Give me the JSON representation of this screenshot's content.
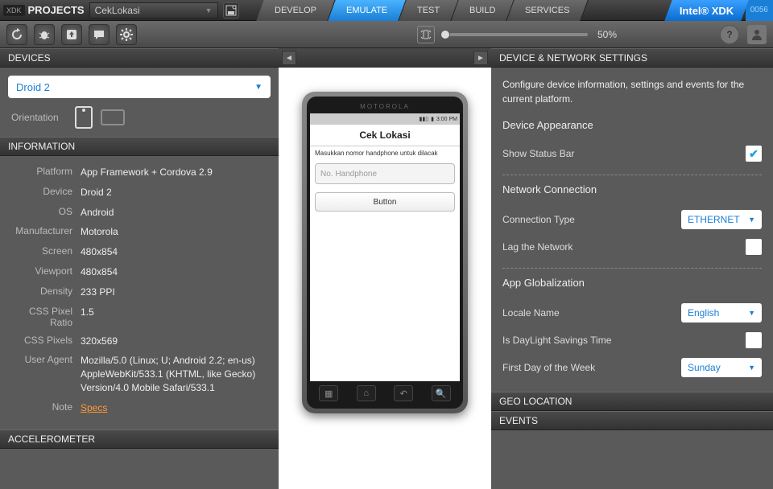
{
  "top": {
    "xdk": "XDK",
    "projects": "PROJECTS",
    "project_name": "CekLokasi",
    "build_no": "0056",
    "brand": "Intel® XDK"
  },
  "tabs": [
    "DEVELOP",
    "EMULATE",
    "TEST",
    "BUILD",
    "SERVICES"
  ],
  "zoom": {
    "label": "50%"
  },
  "devices": {
    "title": "DEVICES",
    "selected": "Droid 2",
    "orientation": "Orientation"
  },
  "info": {
    "title": "INFORMATION",
    "rows": [
      {
        "k": "Platform",
        "v": "App Framework + Cordova 2.9"
      },
      {
        "k": "Device",
        "v": "Droid 2"
      },
      {
        "k": "OS",
        "v": "Android"
      },
      {
        "k": "Manufacturer",
        "v": "Motorola"
      },
      {
        "k": "Screen",
        "v": "480x854"
      },
      {
        "k": "Viewport",
        "v": "480x854"
      },
      {
        "k": "Density",
        "v": "233 PPI"
      },
      {
        "k": "CSS Pixel Ratio",
        "v": "1.5"
      },
      {
        "k": "CSS Pixels",
        "v": "320x569"
      },
      {
        "k": "User Agent",
        "v": "Mozilla/5.0 (Linux; U; Android 2.2; en-us) AppleWebKit/533.1 (KHTML, like Gecko) Version/4.0 Mobile Safari/533.1"
      }
    ],
    "note_k": "Note",
    "note_v": "Specs"
  },
  "accel": {
    "title": "ACCELEROMETER"
  },
  "phone": {
    "brand": "MOTOROLA",
    "time": "3:00 PM",
    "app_title": "Cek Lokasi",
    "prompt": "Masukkan nomor handphone untuk dilacak",
    "placeholder": "No. Handphone",
    "button": "Button"
  },
  "settings": {
    "title": "DEVICE & NETWORK SETTINGS",
    "desc": "Configure device information, settings and events for the current platform.",
    "appearance": "Device Appearance",
    "status_bar": "Show Status Bar",
    "network": "Network Connection",
    "conn_type": "Connection Type",
    "conn_val": "ETHERNET",
    "lag": "Lag the Network",
    "glob": "App Globalization",
    "locale": "Locale Name",
    "locale_val": "English",
    "dst": "Is DayLight Savings Time",
    "firstday": "First Day of the Week",
    "firstday_val": "Sunday"
  },
  "geo": {
    "title": "GEO LOCATION"
  },
  "events": {
    "title": "EVENTS"
  }
}
